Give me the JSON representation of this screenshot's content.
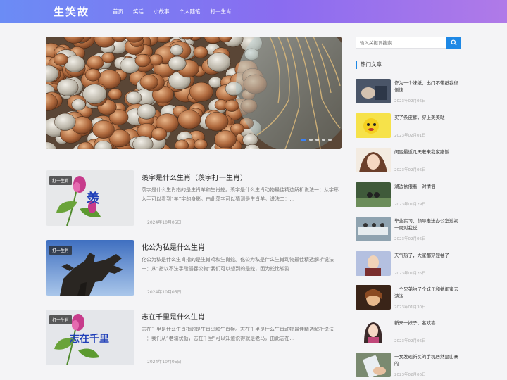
{
  "site": {
    "logo": "生笑故"
  },
  "nav": [
    "首页",
    "笑话",
    "小故事",
    "个人随笔",
    "打一生肖"
  ],
  "search": {
    "placeholder": "输入关键词搜索..."
  },
  "sidebar": {
    "title": "热门文章"
  },
  "articles": [
    {
      "tag": "打一生肖",
      "title": "羡字是什么生肖（羡字打一生肖）",
      "desc": "羡字是什么生肖指的是生肖羊和生肖蛇。羡字是什么生肖动物最佳精选解析说法一：从字形入手可以看到“羊”字的身影。由此羡字可以猜测是生肖羊。说法二：…",
      "date": "2024年10月05日",
      "thumb_text": "羡"
    },
    {
      "tag": "打一生肖",
      "title": "化公为私是什么生肖",
      "desc": "化公为私是什么生肖指的是生肖鸡和生肖蛇。化公为私是什么生肖动物最佳精选解析说法一：从“指以不法手段侵吞公物”我们可以想到的是蛇，因为蛇比较狡…",
      "date": "2024年10月05日"
    },
    {
      "tag": "打一生肖",
      "title": "志在千里是什么生肖",
      "desc": "志在千里是什么生肖指的是生肖马和生肖猴。志在千里是什么生肖动物最佳精选解析说法一：我们从“老骥伏枥，志在千里”可以知道说得就是老马，由此志在…",
      "date": "2024年10月05日",
      "thumb_text": "志在千里"
    }
  ],
  "hot": [
    {
      "title": "作为一个妹纸，出门不带纸我很惭愧",
      "date": "2023年02月06日"
    },
    {
      "title": "买了条皮裤，穿上美美哒",
      "date": "2023年02月01日"
    },
    {
      "title": "闺蜜最近几天老来我家蹭饭",
      "date": "2023年02月06日"
    },
    {
      "title": "湖边依偎着一对情侣",
      "date": "2023年01月29日"
    },
    {
      "title": "毕业实习，领导走进办公室巡视一周对我说",
      "date": "2023年02月06日"
    },
    {
      "title": "天气热了，大家都穿短袖了",
      "date": "2023年01月26日"
    },
    {
      "title": "一个兄弟约了个妹子和她闺蜜去游泳",
      "date": "2023年01月30日"
    },
    {
      "title": "新来一妹子，名欢喜",
      "date": "2023年02月06日"
    },
    {
      "title": "一女发现新买的手机居然是山寨的",
      "date": "2023年02月06日"
    }
  ]
}
